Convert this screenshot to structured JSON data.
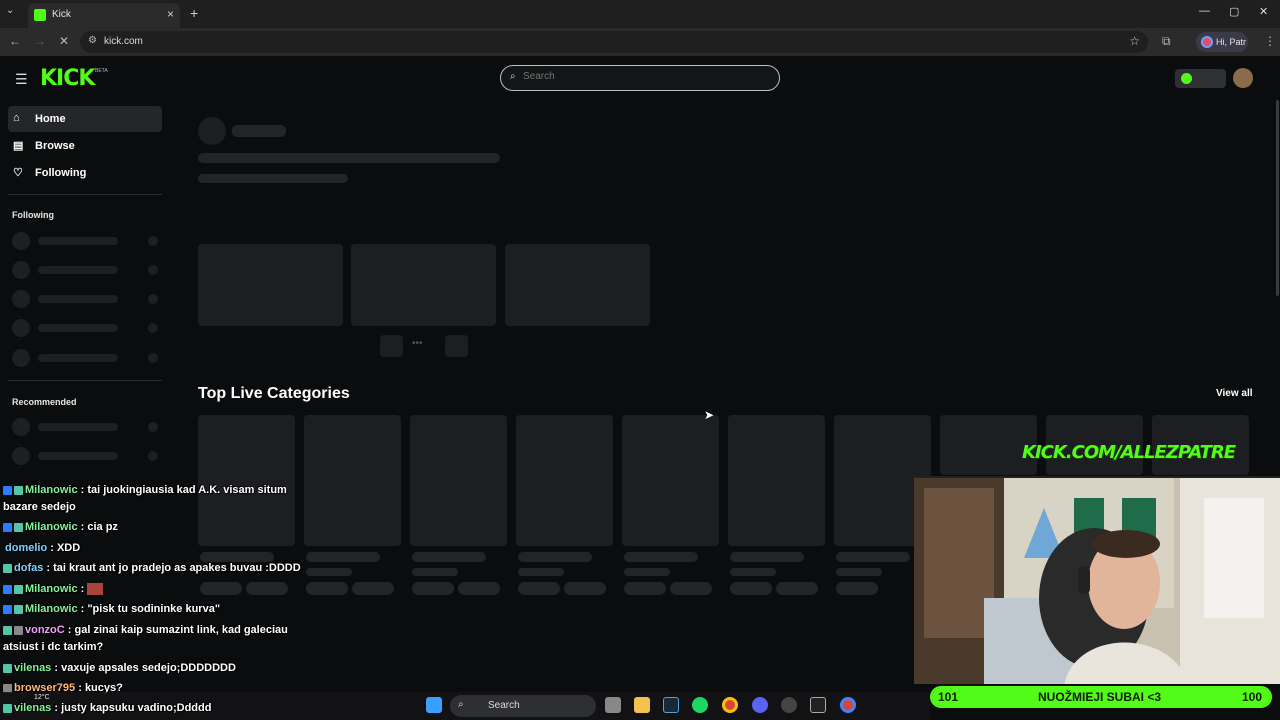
{
  "browser": {
    "tab_title": "Kick",
    "url": "kick.com",
    "profile_label": "Hi, Patr"
  },
  "kick": {
    "logo": "KICK",
    "beta": "BETA",
    "search_placeholder": "Search",
    "nav": [
      {
        "label": "Home",
        "icon": "home-icon",
        "active": true
      },
      {
        "label": "Browse",
        "icon": "browse-icon",
        "active": false
      },
      {
        "label": "Following",
        "icon": "heart-icon",
        "active": false
      }
    ],
    "sidebar_following": "Following",
    "sidebar_recommended": "Recommended",
    "top_live_title": "Top Live Categories",
    "view_all": "View all"
  },
  "overlay": {
    "link": "KICK.COM/ALLEZPATRE",
    "goal": {
      "start": "101",
      "label": "NUOŽMIEJI SUBAI <3",
      "end": "100",
      "progress_fraction": 1.0
    },
    "chat": [
      {
        "user": "Milanowic",
        "text": ": tai juokingiausia kad A.K. visam situm",
        "cont": "bazare sedejo"
      },
      {
        "user": "Milanowic",
        "text": ": cia pz"
      },
      {
        "user": "domelio",
        "text": ": XDD"
      },
      {
        "user": "dofas",
        "text": ": tai kraut ant jo pradejo as apakes buvau :DDDD"
      },
      {
        "user": "Milanowic",
        "text": ":"
      },
      {
        "user": "Milanowic",
        "text": ": \"pisk tu sodininke kurva\""
      },
      {
        "user": "vonzoC",
        "text": ": gal zinai kaip sumazint link, kad galeciau",
        "cont": "atsiust i dc tarkim?"
      },
      {
        "user": "vilenas",
        "text": ": vaxuje apsales sedejo;DDDDDDD"
      },
      {
        "user": "browser795",
        "text": ": kucys?"
      },
      {
        "user": "vilenas",
        "text": ": justy kapsuku vadino;Ddddd"
      }
    ]
  },
  "taskbar": {
    "search_label": "Search",
    "weather": "12°C"
  }
}
